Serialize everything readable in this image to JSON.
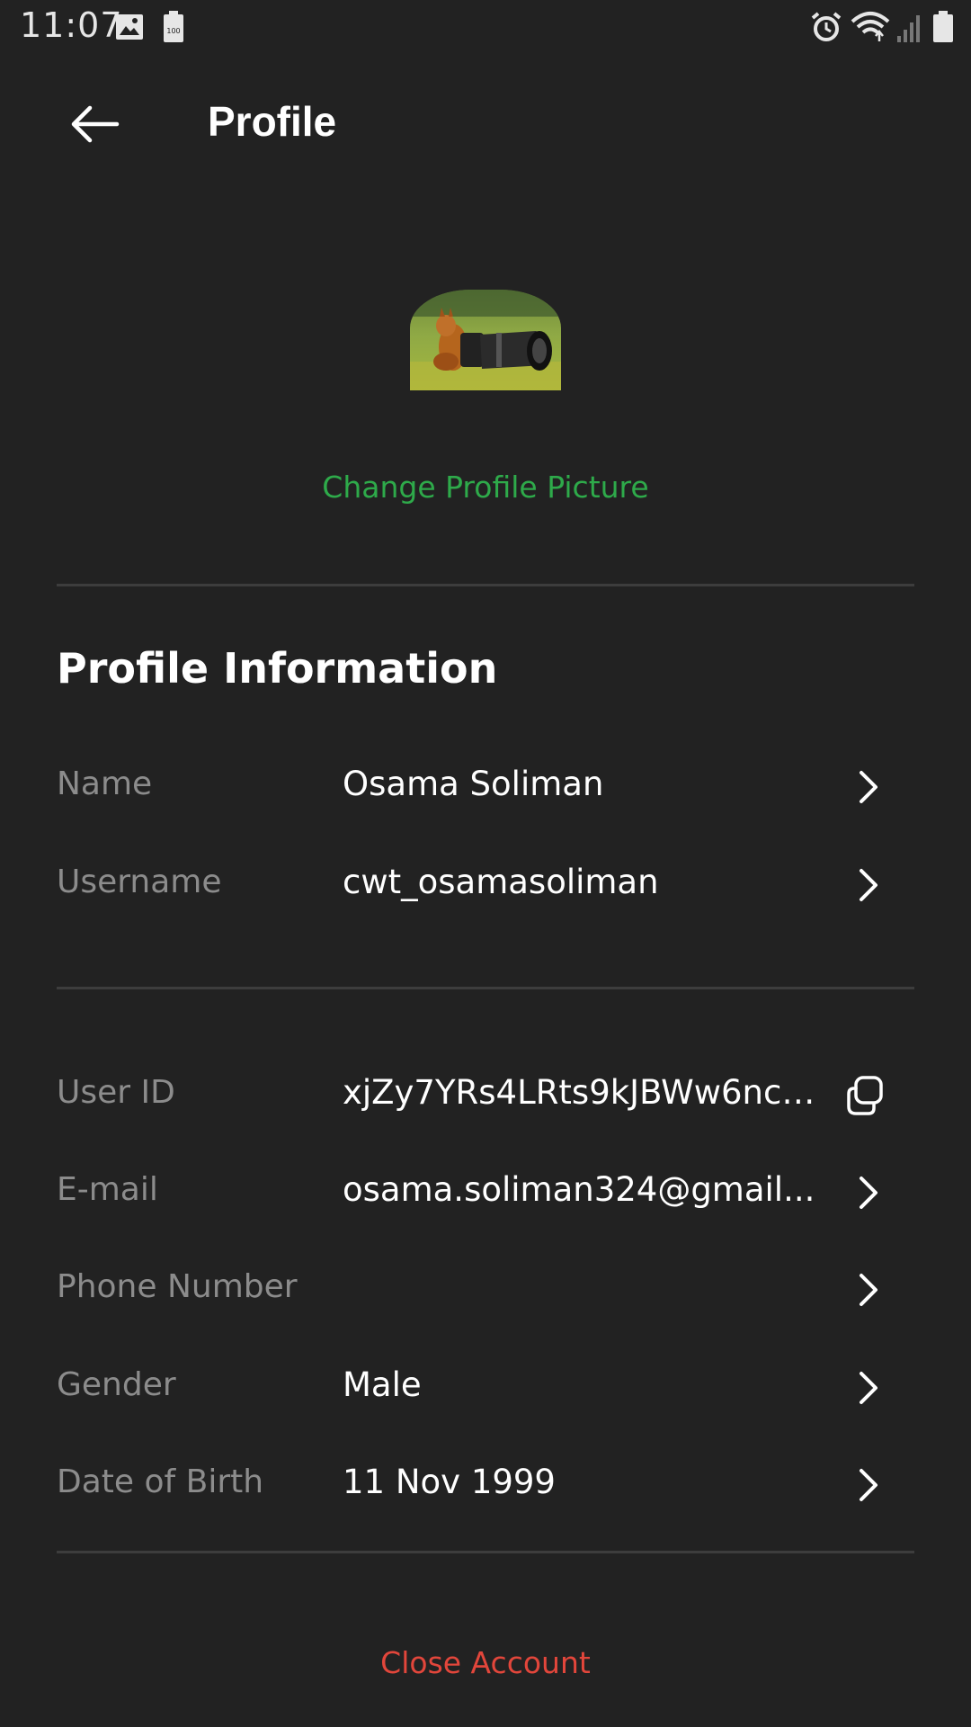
{
  "status_bar": {
    "time": "11:07",
    "left_icons": [
      "gallery-icon",
      "battery-saver-icon"
    ],
    "right_icons": [
      "alarm-icon",
      "wifi-icon",
      "signal-icon",
      "battery-icon"
    ]
  },
  "app_bar": {
    "title": "Profile",
    "back_icon": "arrow-left-icon"
  },
  "profile_picture": {
    "change_label": "Change Profile Picture"
  },
  "profile_info": {
    "section_title": "Profile Information",
    "rows": [
      {
        "label": "Name",
        "value": "Osama Soliman",
        "action_icon": "chevron-right-icon"
      },
      {
        "label": "Username",
        "value": "cwt_osamasoliman",
        "action_icon": "chevron-right-icon"
      }
    ]
  },
  "account_info": {
    "rows": [
      {
        "label": "User ID",
        "value": "xjZy7YRs4LRts9kJBWw6nc5...",
        "action_icon": "copy-icon"
      },
      {
        "label": "E-mail",
        "value": "osama.soliman324@gmail...",
        "action_icon": "chevron-right-icon"
      },
      {
        "label": "Phone Number",
        "value": "",
        "action_icon": "chevron-right-icon"
      },
      {
        "label": "Gender",
        "value": "Male",
        "action_icon": "chevron-right-icon"
      },
      {
        "label": "Date of Birth",
        "value": "11 Nov 1999",
        "action_icon": "chevron-right-icon"
      }
    ]
  },
  "footer": {
    "close_account_label": "Close Account"
  },
  "colors": {
    "background": "#222222",
    "accent_green": "#2eaa4a",
    "danger_red": "#e2463b",
    "label_gray": "#8c8c8c",
    "divider": "#3d3d3d"
  }
}
